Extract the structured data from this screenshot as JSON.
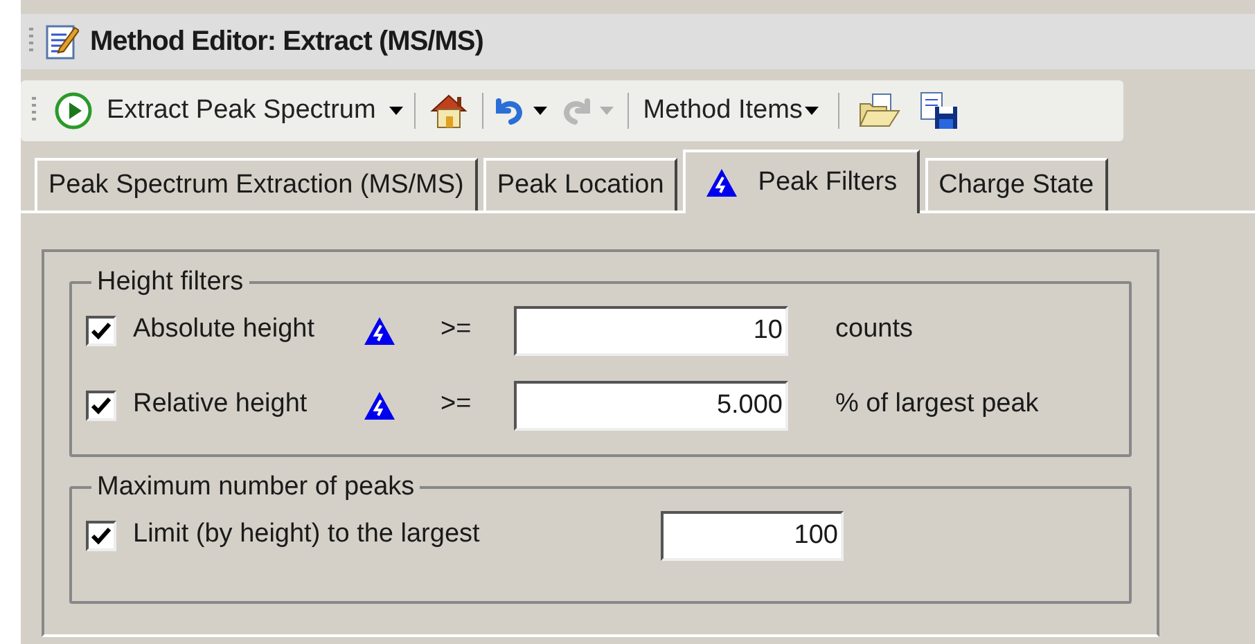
{
  "window": {
    "title": "Method Editor: Extract (MS/MS)"
  },
  "toolbar": {
    "run_button": {
      "label": "Extract Peak Spectrum"
    },
    "undo": {
      "disabled": false
    },
    "redo": {
      "disabled": true
    },
    "method_items": {
      "label": "Method Items"
    }
  },
  "tabs": [
    {
      "label": "Peak Spectrum Extraction (MS/MS)",
      "selected": false,
      "marked": false
    },
    {
      "label": "Peak Location",
      "selected": false,
      "marked": false
    },
    {
      "label": "Peak Filters",
      "selected": true,
      "marked": true
    },
    {
      "label": "Charge State",
      "selected": false,
      "marked": false
    }
  ],
  "height_filters": {
    "title": "Height filters",
    "rows": [
      {
        "label": "Absolute height",
        "checked": true,
        "marked": true,
        "operator": ">=",
        "value": "10",
        "unit": "counts"
      },
      {
        "label": "Relative height",
        "checked": true,
        "marked": true,
        "operator": ">=",
        "value": "5.000",
        "unit": "% of largest peak"
      }
    ]
  },
  "max_peaks": {
    "title": "Maximum number of peaks",
    "label": "Limit (by height) to the largest",
    "checked": true,
    "value": "100"
  }
}
